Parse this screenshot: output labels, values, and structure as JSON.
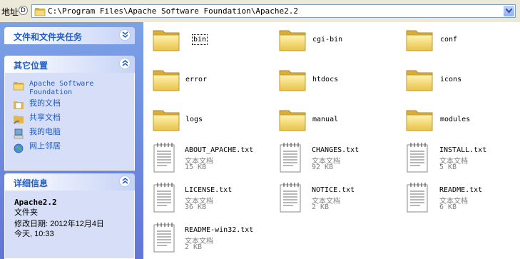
{
  "address": {
    "label": "地址",
    "help_glyph": "D",
    "path": "C:\\Program Files\\Apache Software Foundation\\Apache2.2"
  },
  "tasks_panel": {
    "title": "文件和文件夹任务"
  },
  "places_panel": {
    "title": "其它位置",
    "items": [
      {
        "label_line1": "Apache Software",
        "label_line2": "Foundation",
        "icon": "folder-icon"
      },
      {
        "label": "我的文档",
        "icon": "my-documents-icon"
      },
      {
        "label": "共享文档",
        "icon": "shared-documents-icon"
      },
      {
        "label": "我的电脑",
        "icon": "my-computer-icon"
      },
      {
        "label": "网上邻居",
        "icon": "network-icon"
      }
    ]
  },
  "details_panel": {
    "title": "详细信息",
    "name": "Apache2.2",
    "type": "文件夹",
    "modified": "修改日期: 2012年12月4日",
    "time": "今天, 10:33"
  },
  "folders": [
    {
      "name": "bin"
    },
    {
      "name": "cgi-bin"
    },
    {
      "name": "conf"
    },
    {
      "name": "error"
    },
    {
      "name": "htdocs"
    },
    {
      "name": "icons"
    },
    {
      "name": "logs"
    },
    {
      "name": "manual"
    },
    {
      "name": "modules"
    }
  ],
  "files": [
    {
      "name": "ABOUT_APACHE.txt",
      "type": "文本文档",
      "size": "15 KB"
    },
    {
      "name": "CHANGES.txt",
      "type": "文本文档",
      "size": "92 KB"
    },
    {
      "name": "INSTALL.txt",
      "type": "文本文档",
      "size": "5 KB"
    },
    {
      "name": "LICENSE.txt",
      "type": "文本文档",
      "size": "36 KB"
    },
    {
      "name": "NOTICE.txt",
      "type": "文本文档",
      "size": "2 KB"
    },
    {
      "name": "README.txt",
      "type": "文本文档",
      "size": "6 KB"
    },
    {
      "name": "README-win32.txt",
      "type": "文本文档",
      "size": "2 KB"
    }
  ]
}
